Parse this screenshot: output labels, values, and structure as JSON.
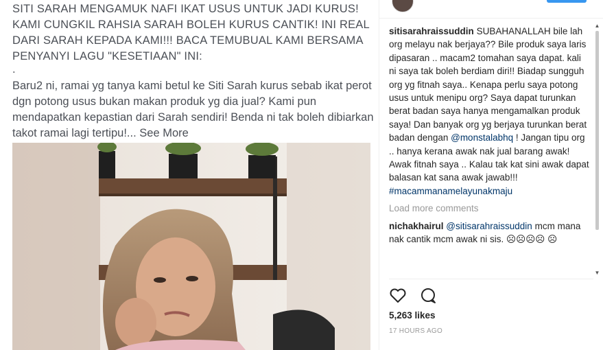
{
  "post": {
    "lines": [
      "SITI SARAH MENGAMUK NAFI IKAT USUS UNTUK JADI KURUS!",
      "KAMI CUNGKIL RAHSIA SARAH BOLEH KURUS CANTIK! INI REAL",
      "DARI SARAH KEPADA KAMI!!! BACA TEMUBUAL KAMI BERSAMA",
      "PENYANYI LAGU \"KESETIAAN\" INI:",
      ".",
      "Baru2 ni, ramai yg tanya kami betul ke Siti Sarah kurus sebab ikat perot",
      "dgn potong usus bukan makan produk yg dia jual? Kami pun",
      "mendapatkan kepastian dari Sarah sendiri! Benda ni tak boleh dibiarkan",
      "takot ramai lagi tertipu!..."
    ],
    "see_more": "See More"
  },
  "caption": {
    "username": "sitisarahraissuddin",
    "text_before_mention": "SUBAHANALLAH bile lah org melayu nak berjaya?? Bile produk saya laris dipasaran .. macam2 tomahan saya dapat. kali ni saya tak boleh berdiam diri!! Biadap sungguh org yg fitnah saya.. Kenapa perlu saya potong usus untuk menipu org? Saya dapat turunkan berat badan saya hanya mengamalkan produk saya! Dan banyak org yg berjaya turunkan berat badan dengan",
    "mention": "@monstalabhq",
    "text_after_mention": "! Jangan tipu org .. hanya kerana awak nak jual barang awak! Awak fitnah saya .. Kalau tak kat sini awak dapat balasan kat sana awak jawab!!!",
    "hashtag": "#macammanamelayunakmaju"
  },
  "load_more": "Load more comments",
  "comment": {
    "username": "nichakhairul",
    "mention": "@sitisarahraissuddin",
    "text": "mcm mana nak cantik mcm awak ni sis. ☹☹☹☹ ☹"
  },
  "likes": "5,263 likes",
  "time": "17 HOURS AGO",
  "icons": {
    "like": "heart-icon",
    "comment": "comment-bubble-icon"
  },
  "colors": {
    "link": "#003569",
    "muted": "#999999",
    "follow": "#3897f0"
  }
}
